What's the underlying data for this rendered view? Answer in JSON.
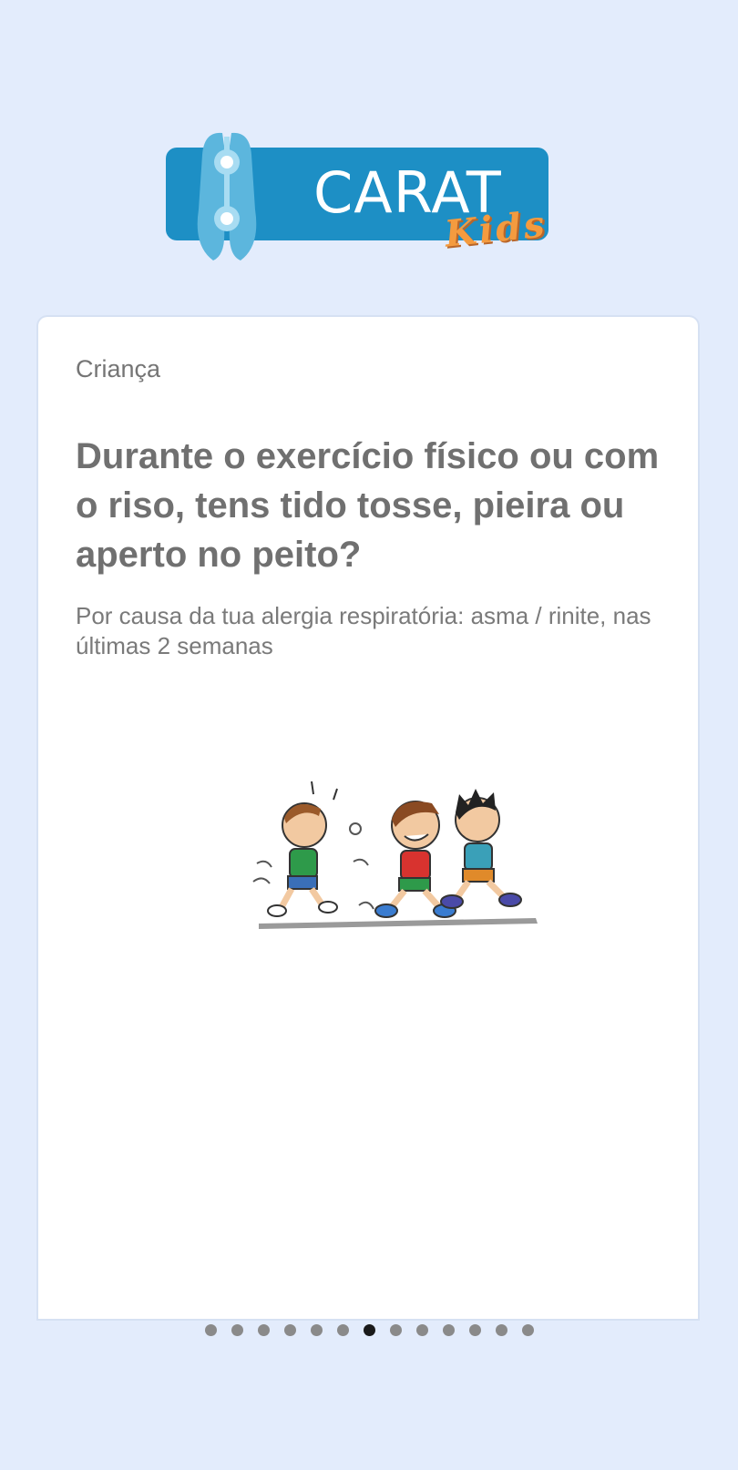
{
  "logo": {
    "brand": "CARAT",
    "sub": "Kids",
    "colors": {
      "bar": "#1d8fc5",
      "kids": "#f49b3f"
    }
  },
  "card": {
    "category": "Criança",
    "question": "Durante o exercício físico ou com o riso, tens tido tosse, pieira ou aperto no peito?",
    "subtitle": "Por causa da tua alergia respiratória: asma / rinite, nas últimas 2 semanas",
    "illustration_icon": "running-kids-illustration"
  },
  "pagination": {
    "total": 13,
    "active_index": 6
  }
}
